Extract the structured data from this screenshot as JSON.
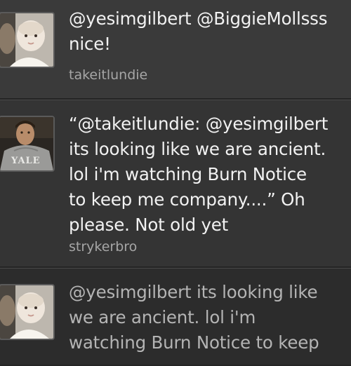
{
  "tweets": [
    {
      "text": "@yesimgilbert @BiggieMollsss\nnice!",
      "username": "takeitlundie",
      "avatar": "baby-photo-icon"
    },
    {
      "text": "“@takeitlundie: @yesimgilbert\nits looking like we are ancient.\nlol i'm watching Burn Notice\nto keep me company....” Oh\nplease. Not old yet",
      "username": "strykerbro",
      "avatar": "man-in-yale-hoodie-photo-icon"
    },
    {
      "text": "@yesimgilbert its looking like\nwe are ancient. lol i'm\nwatching Burn Notice to keep",
      "username": "",
      "avatar": "baby-photo-icon"
    }
  ],
  "colors": {
    "background": "#333333",
    "tweet_text": "#f2f2f2",
    "username_text": "#a6a6a6",
    "dimmed_text": "#b4b4b4"
  }
}
